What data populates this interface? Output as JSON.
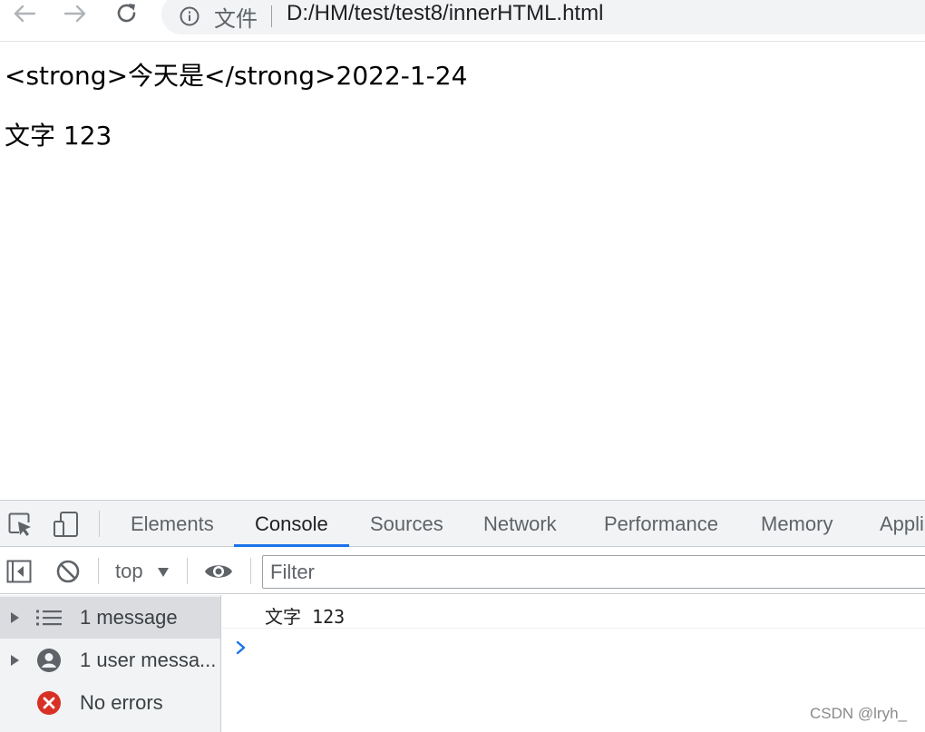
{
  "browser": {
    "scheme_label": "文件",
    "url": "D:/HM/test/test8/innerHTML.html",
    "icons": {
      "back": "arrow-left-icon",
      "forward": "arrow-right-icon",
      "reload": "reload-icon",
      "info": "info-icon"
    }
  },
  "page": {
    "lines": [
      "<strong>今天是</strong>2022-1-24",
      "文字 123"
    ]
  },
  "devtools": {
    "tabs": [
      {
        "label": "Elements",
        "active": false
      },
      {
        "label": "Console",
        "active": true
      },
      {
        "label": "Sources",
        "active": false
      },
      {
        "label": "Network",
        "active": false
      },
      {
        "label": "Performance",
        "active": false
      },
      {
        "label": "Memory",
        "active": false
      },
      {
        "label": "Appli",
        "active": false
      }
    ],
    "context": "top",
    "filter_placeholder": "Filter",
    "sidebar": [
      {
        "label": "1 message",
        "icon": "list-icon",
        "selected": true,
        "expandable": true
      },
      {
        "label": "1 user messa...",
        "icon": "user-icon",
        "selected": false,
        "expandable": true
      },
      {
        "label": "No errors",
        "icon": "error-icon",
        "selected": false,
        "expandable": false
      }
    ],
    "log": [
      "文字 123"
    ]
  },
  "watermark": "CSDN @lryh_",
  "colors": {
    "accent": "#1a73e8",
    "error": "#d93025",
    "toolbar_bg": "#f1f3f4"
  }
}
